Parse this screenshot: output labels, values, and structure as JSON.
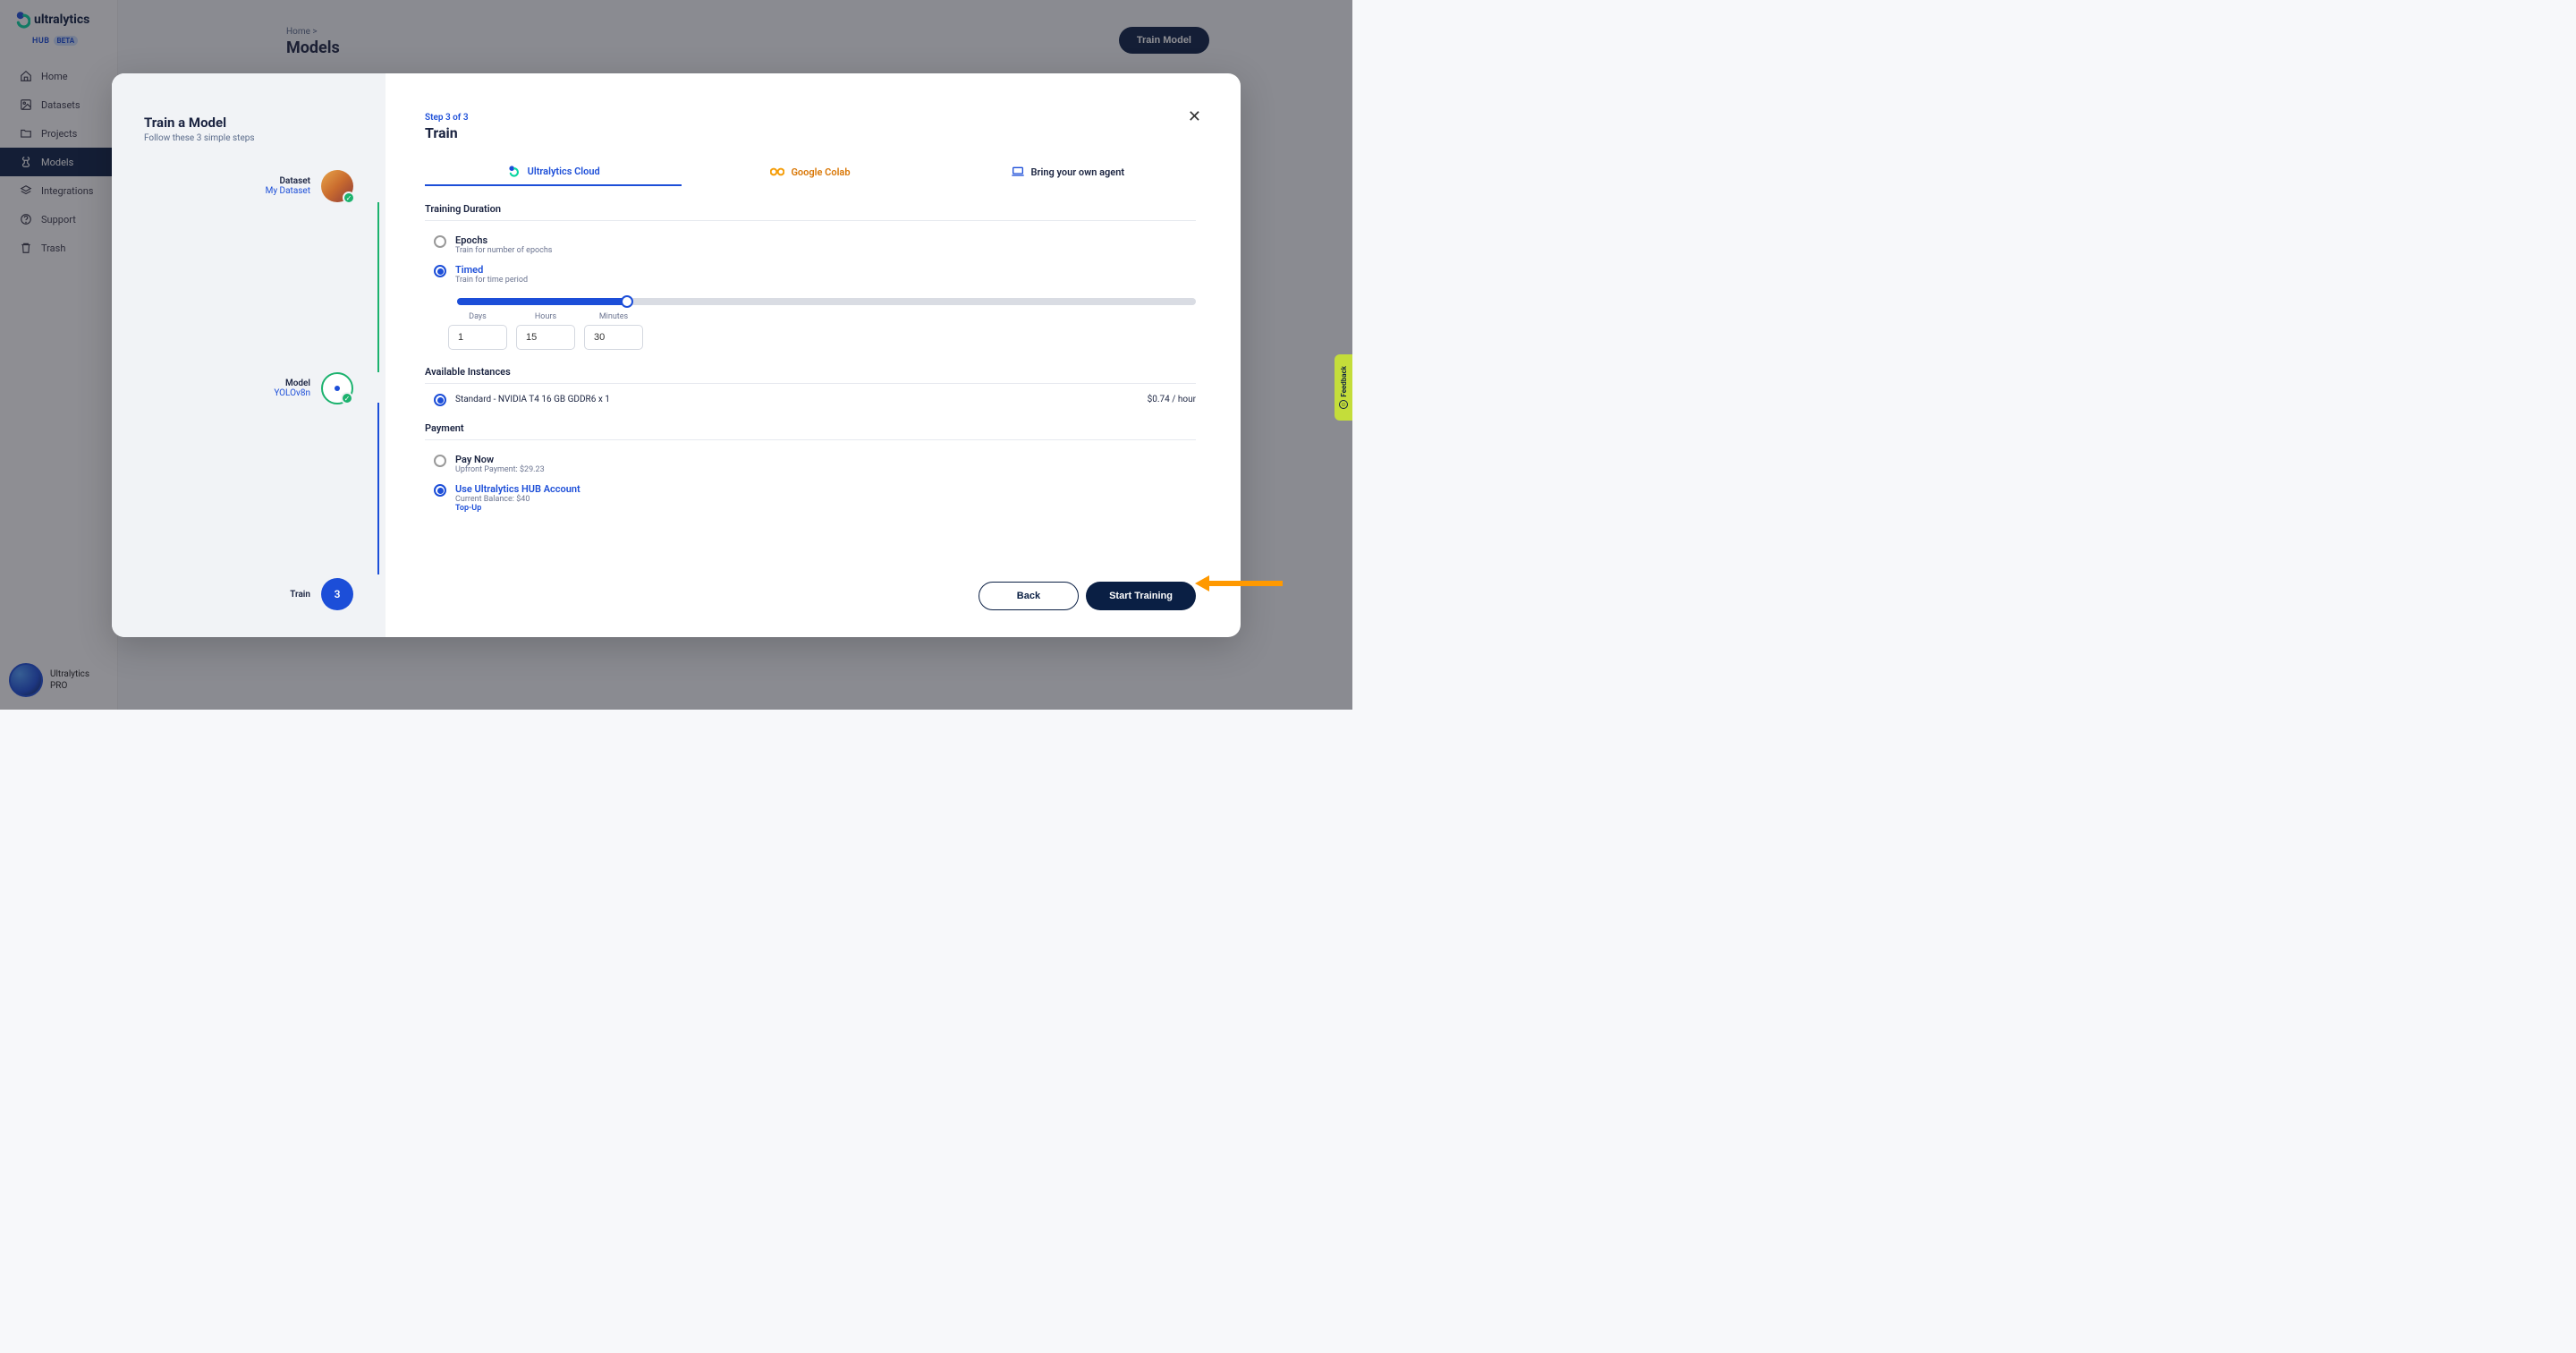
{
  "brand": {
    "name": "ultralytics",
    "hub": "HUB",
    "badge": "BETA"
  },
  "nav": {
    "home": "Home",
    "datasets": "Datasets",
    "projects": "Projects",
    "models": "Models",
    "integrations": "Integrations",
    "support": "Support",
    "trash": "Trash"
  },
  "user": {
    "line1": "Ultralytics",
    "line2": "PRO"
  },
  "breadcrumb": "Home  >",
  "page_title": "Models",
  "topbtn": "Train Model",
  "modal": {
    "left_title": "Train a Model",
    "left_sub": "Follow these 3 simple steps",
    "steps": {
      "dataset": {
        "label": "Dataset",
        "value": "My Dataset"
      },
      "model": {
        "label": "Model",
        "value": "YOLOv8n"
      },
      "train": {
        "label": "Train",
        "num": "3"
      }
    },
    "step_ind": "Step 3 of 3",
    "title": "Train",
    "tabs": {
      "cloud": "Ultralytics Cloud",
      "colab": "Google Colab",
      "agent": "Bring your own agent"
    },
    "sections": {
      "duration": "Training Duration",
      "instances": "Available Instances",
      "payment": "Payment"
    },
    "duration": {
      "epochs": {
        "title": "Epochs",
        "sub": "Train for number of epochs"
      },
      "timed": {
        "title": "Timed",
        "sub": "Train for time period"
      },
      "days_lbl": "Days",
      "hours_lbl": "Hours",
      "minutes_lbl": "Minutes",
      "days": "1",
      "hours": "15",
      "minutes": "30"
    },
    "instance": {
      "name": "Standard - NVIDIA T4 16 GB GDDR6 x 1",
      "price": "$0.74 / hour"
    },
    "payment": {
      "paynow": {
        "title": "Pay Now",
        "sub": "Upfront Payment: $29.23"
      },
      "account": {
        "title": "Use Ultralytics HUB Account",
        "sub": "Current Balance: $40",
        "topup": "Top-Up"
      }
    },
    "buttons": {
      "back": "Back",
      "start": "Start Training"
    }
  },
  "feedback": "Feedback"
}
